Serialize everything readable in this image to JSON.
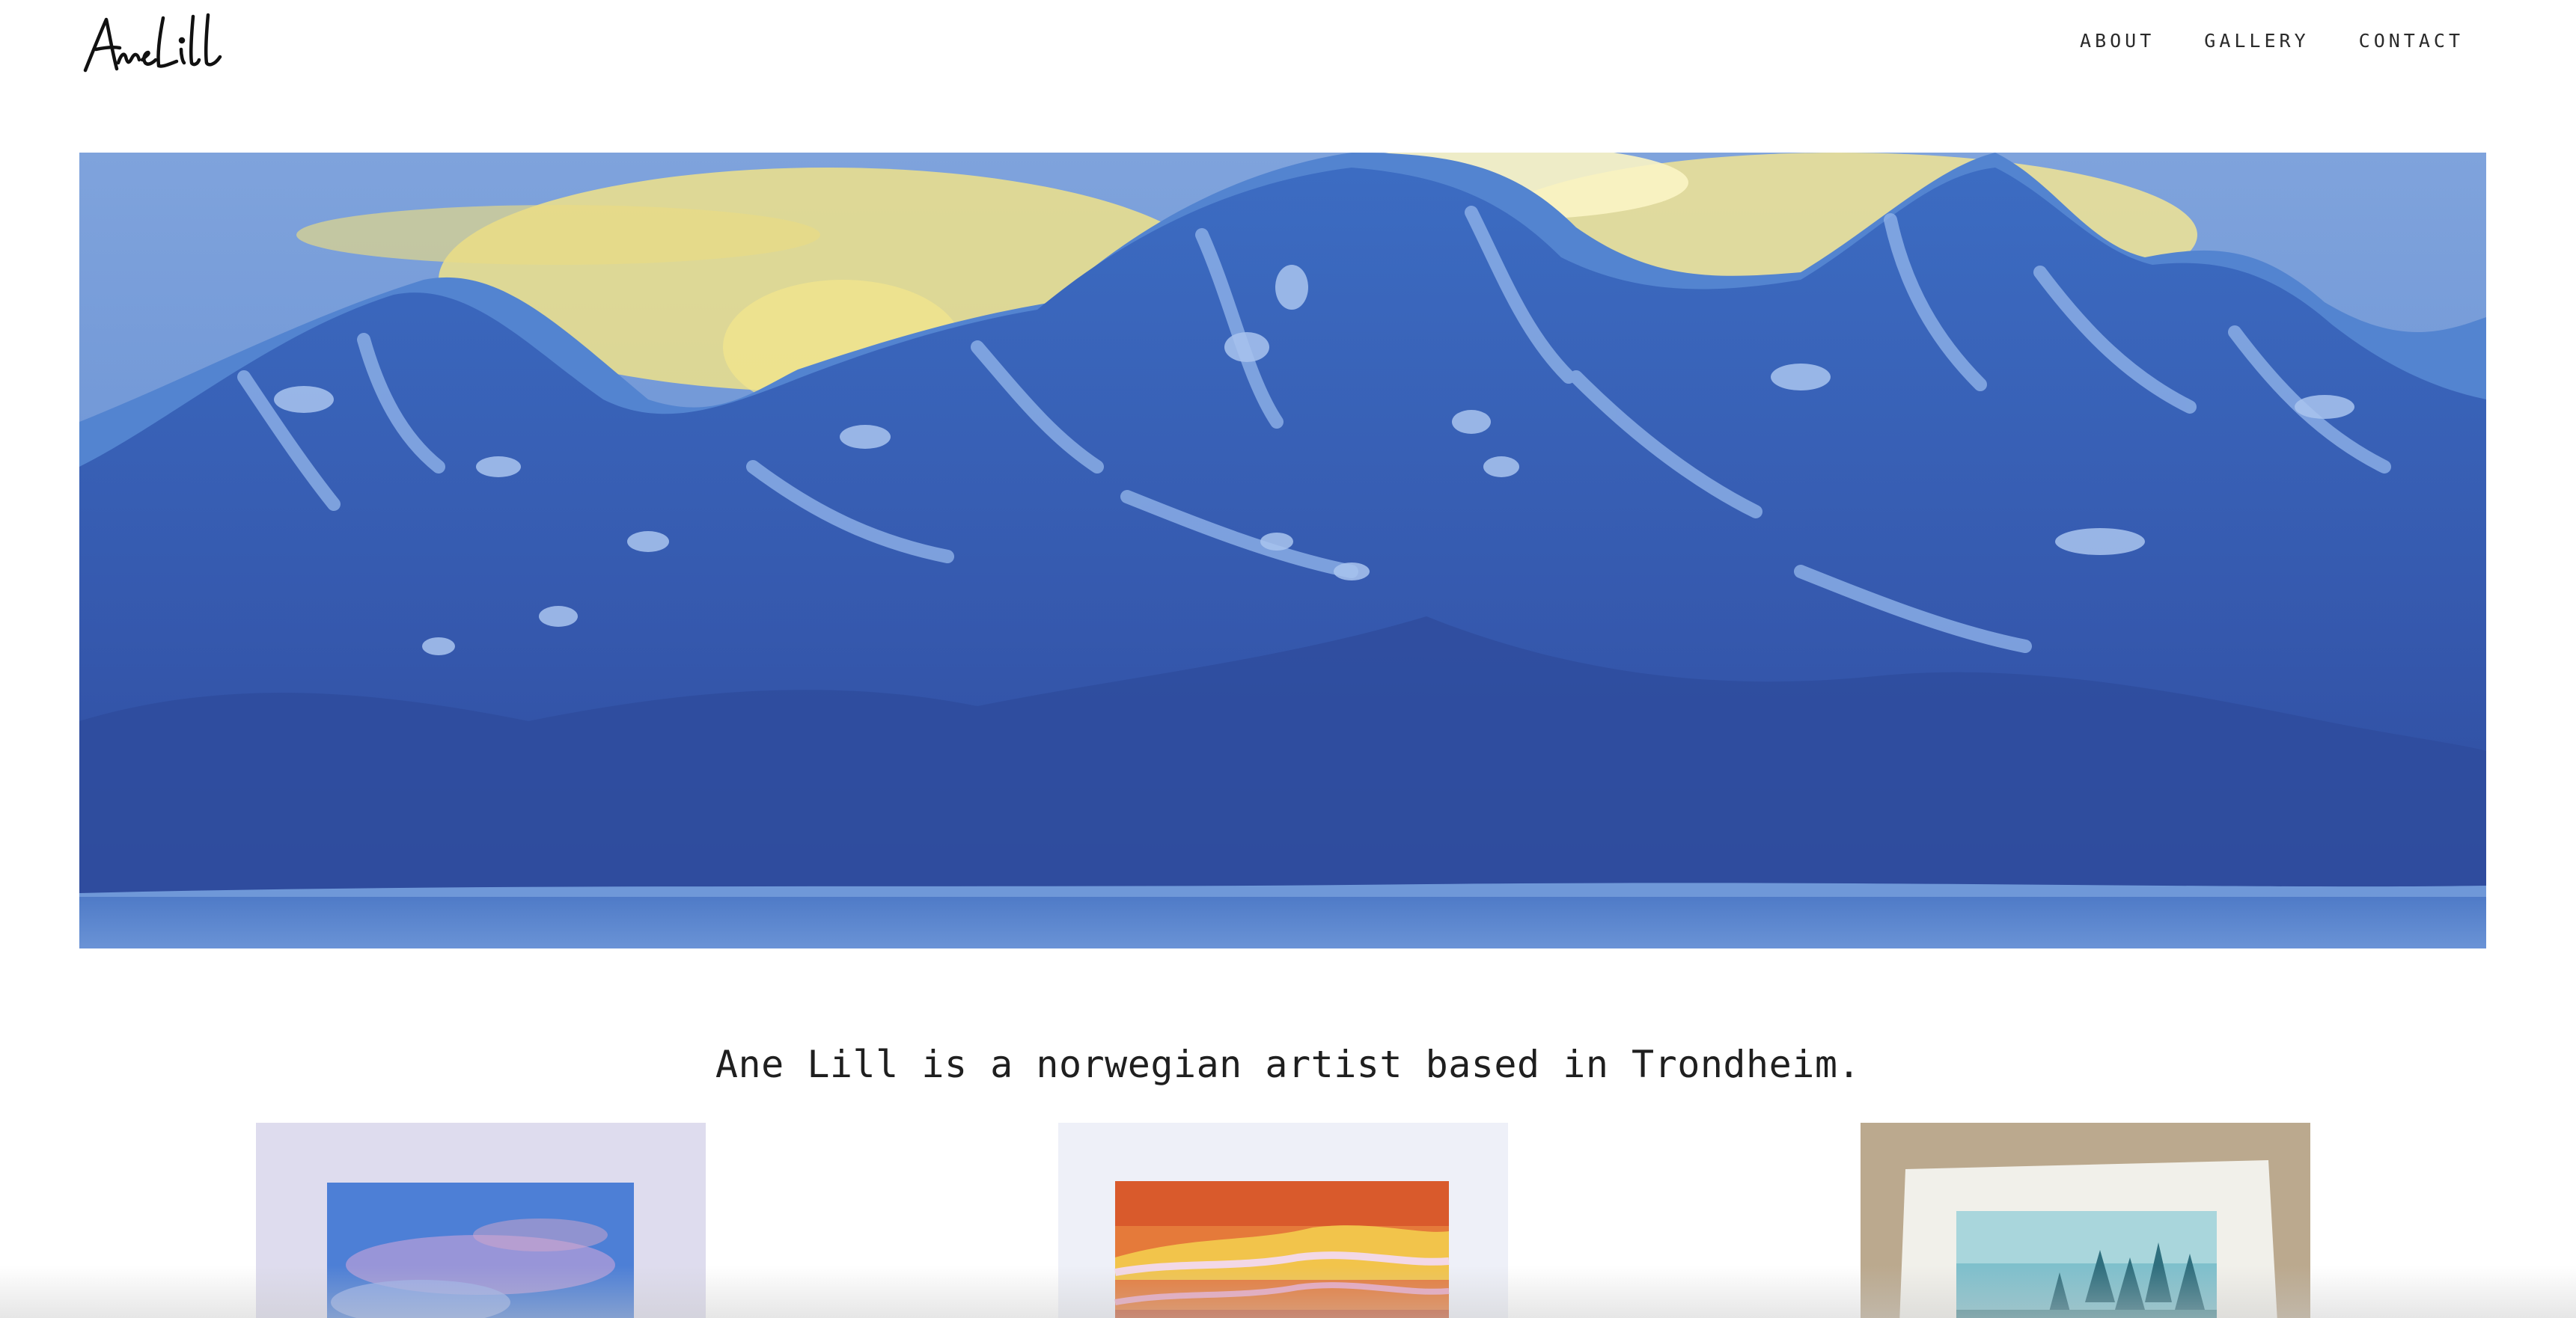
{
  "header": {
    "logo_text": "AneLill",
    "nav": [
      {
        "label": "ABOUT"
      },
      {
        "label": "GALLERY"
      },
      {
        "label": "CONTACT"
      }
    ]
  },
  "hero": {
    "image": "painting-blue-mountains-yellow-sky"
  },
  "intro": {
    "text": "Ane Lill is a norwegian artist based in Trondheim."
  },
  "gallery": {
    "items": [
      {
        "image": "painting-blue-sky-pink-clouds"
      },
      {
        "image": "painting-orange-sunset-landscape"
      },
      {
        "image": "painting-teal-forest-watercolor"
      }
    ]
  }
}
